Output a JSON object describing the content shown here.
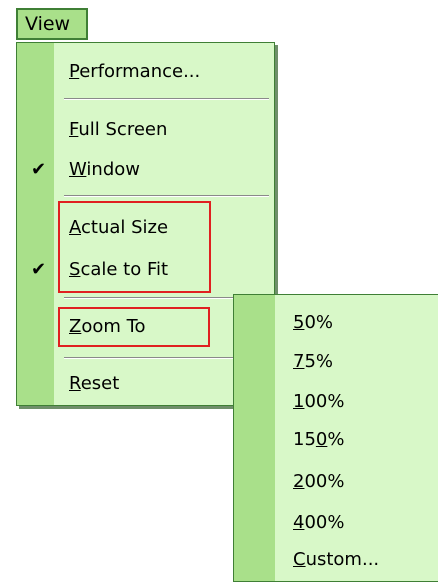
{
  "menubar": {
    "view_label": "View"
  },
  "main_menu": {
    "performance": {
      "mnemonic": "P",
      "rest": "erformance..."
    },
    "full_screen": {
      "mnemonic": "F",
      "rest": "ull Screen"
    },
    "window": {
      "mnemonic": "W",
      "rest": "indow",
      "checked": true
    },
    "actual_size": {
      "mnemonic": "A",
      "rest": "ctual Size"
    },
    "scale_to_fit": {
      "mnemonic": "S",
      "rest": "cale to Fit",
      "checked": true
    },
    "zoom_to": {
      "mnemonic": "Z",
      "rest": "oom To"
    },
    "reset": {
      "mnemonic": "R",
      "rest": "eset"
    },
    "check_glyph": "✔"
  },
  "zoom_submenu": {
    "items": [
      {
        "mnemonic": "5",
        "rest": "0%"
      },
      {
        "mnemonic": "7",
        "rest": "5%"
      },
      {
        "mnemonic": "1",
        "rest": "00%"
      },
      {
        "pre": "15",
        "mnemonic": "0",
        "rest": "%"
      },
      {
        "mnemonic": "2",
        "rest": "00%"
      },
      {
        "mnemonic": "4",
        "rest": "00%"
      },
      {
        "mnemonic": "C",
        "rest": "ustom..."
      }
    ]
  },
  "colors": {
    "menu_background": "#d8f8c8",
    "gutter": "#a9e08a",
    "border": "#3f7f35",
    "highlight_box": "#e02020"
  }
}
